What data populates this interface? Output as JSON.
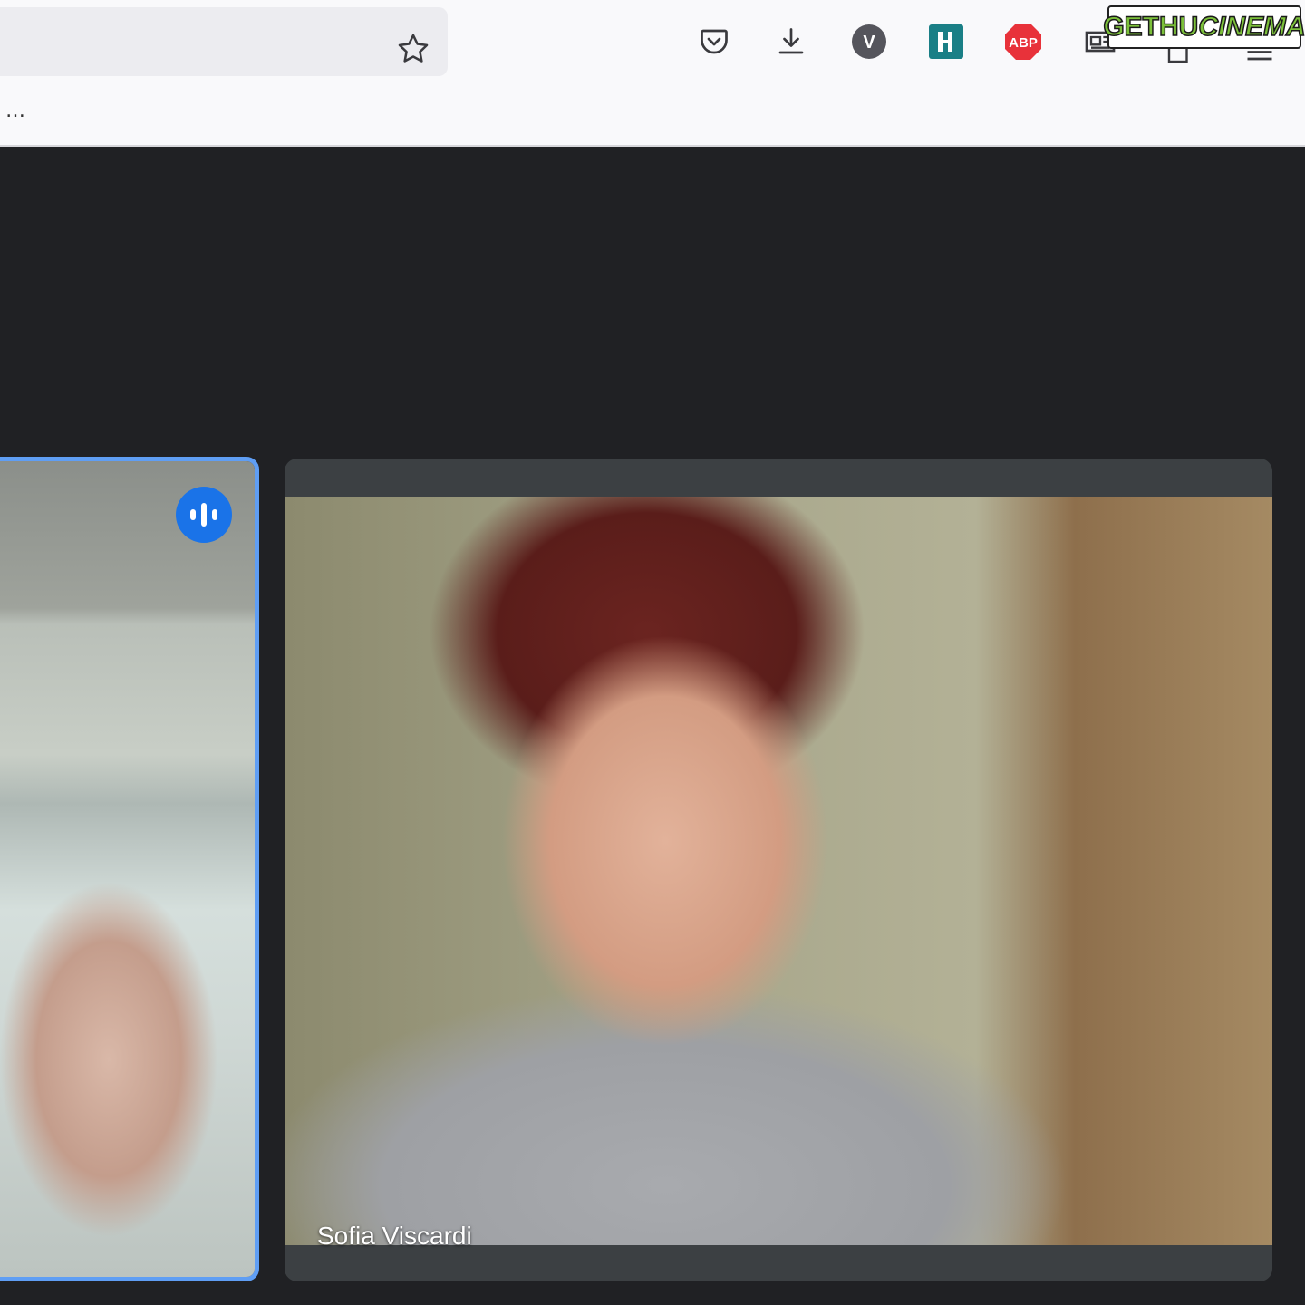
{
  "toolbar": {
    "bookmark_star_icon": "star-icon",
    "extensions": [
      {
        "name": "pocket-icon"
      },
      {
        "name": "download-icon"
      },
      {
        "name": "v-extension-icon",
        "label": "V"
      },
      {
        "name": "h-extension-icon"
      },
      {
        "name": "adblock-icon",
        "label": "ABP"
      },
      {
        "name": "reader-icon"
      }
    ]
  },
  "bookmarks": {
    "overflow": "…"
  },
  "watermark": {
    "part1": "GETHU",
    "part2": "CINEMA"
  },
  "meeting": {
    "main_participant": "Sofia Viscardi",
    "active_speaker_indicator": "audio-bars-icon"
  },
  "colors": {
    "speaking_border": "#5f9ef4",
    "speaking_badge": "#1a73e8",
    "abp_red": "#e8323a",
    "h_teal": "#1a7f86"
  }
}
